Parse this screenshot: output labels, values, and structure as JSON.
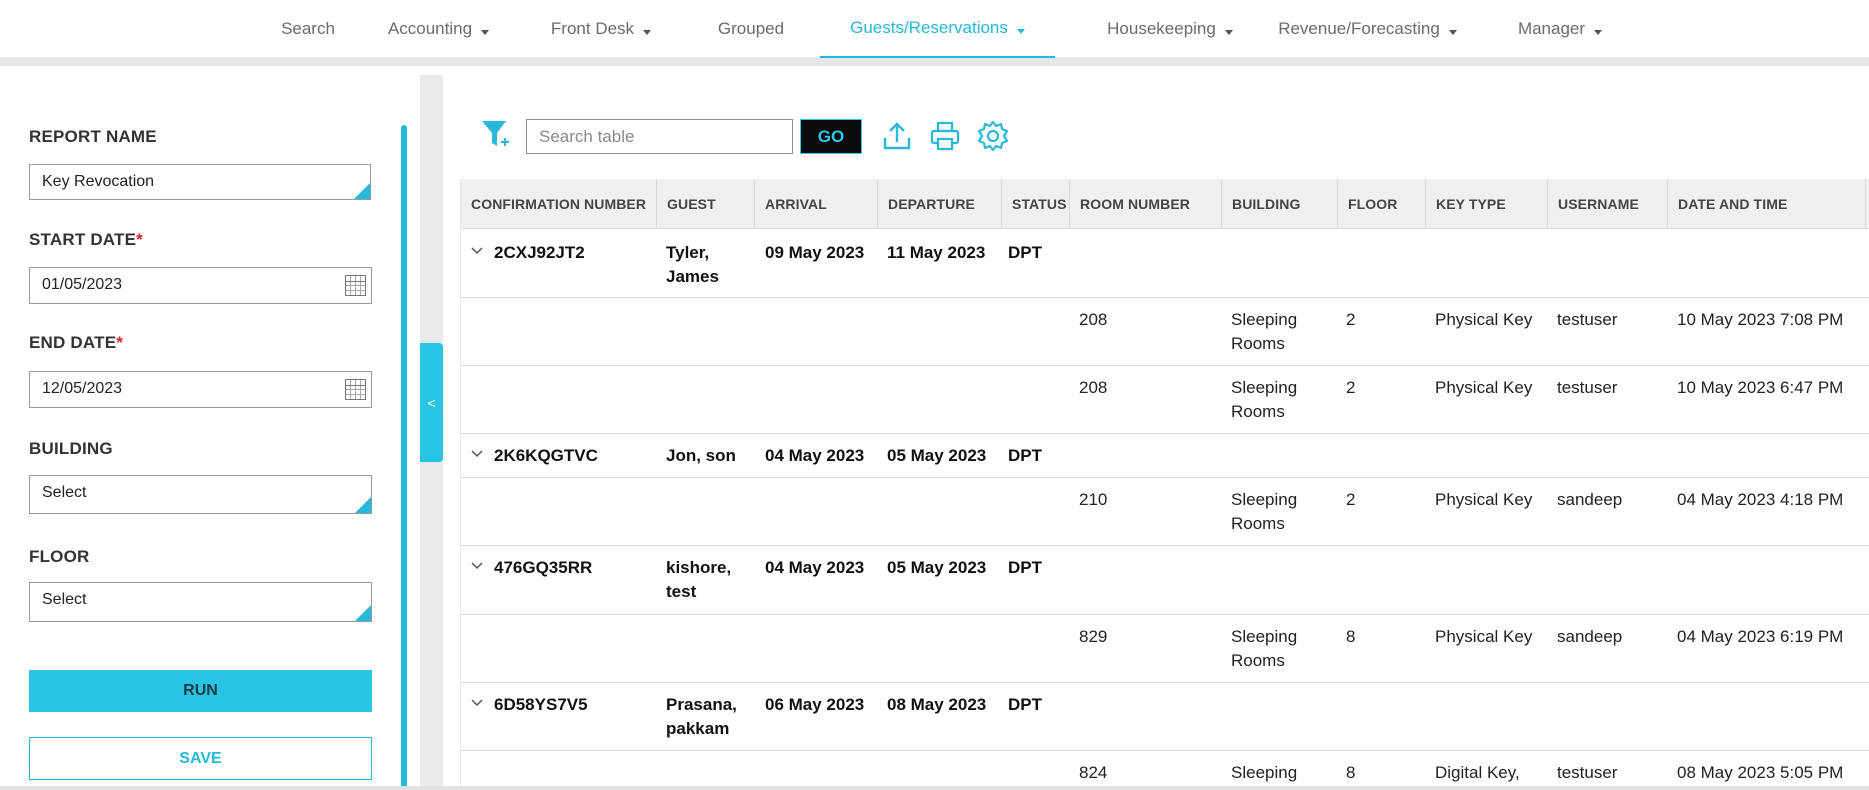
{
  "nav": {
    "items": [
      {
        "label": "Search",
        "dropdown": false,
        "active": false
      },
      {
        "label": "Accounting",
        "dropdown": true,
        "active": false
      },
      {
        "label": "Front Desk",
        "dropdown": true,
        "active": false
      },
      {
        "label": "Grouped",
        "dropdown": false,
        "active": false
      },
      {
        "label": "Guests/Reservations",
        "dropdown": true,
        "active": true
      },
      {
        "label": "Housekeeping",
        "dropdown": true,
        "active": false
      },
      {
        "label": "Revenue/Forecasting",
        "dropdown": true,
        "active": false
      },
      {
        "label": "Manager",
        "dropdown": true,
        "active": false
      }
    ]
  },
  "form": {
    "report_name_label": "REPORT NAME",
    "report_name_value": "Key Revocation",
    "start_date_label": "START DATE",
    "start_date_value": "01/05/2023",
    "end_date_label": "END DATE",
    "end_date_value": "12/05/2023",
    "required_mark": "*",
    "building_label": "BUILDING",
    "building_value": "Select",
    "floor_label": "FLOOR",
    "floor_value": "Select",
    "run_label": "RUN",
    "save_label": "SAVE",
    "collapse_glyph": "<"
  },
  "toolbar": {
    "search_placeholder": "Search table",
    "go_label": "GO"
  },
  "table": {
    "headers": [
      "CONFIRMATION NUMBER",
      "GUEST",
      "ARRIVAL",
      "DEPARTURE",
      "STATUS",
      "ROOM NUMBER",
      "BUILDING",
      "FLOOR",
      "KEY TYPE",
      "USERNAME",
      "DATE AND TIME"
    ],
    "groups": [
      {
        "confirmation": "2CXJ92JT2",
        "guest": "Tyler, James",
        "arrival": "09 May 2023",
        "departure": "11 May 2023",
        "status": "DPT",
        "details": [
          {
            "room": "208",
            "building": "Sleeping Rooms",
            "floor": "2",
            "key_type": "Physical Key",
            "username": "testuser",
            "datetime": "10 May 2023 7:08 PM"
          },
          {
            "room": "208",
            "building": "Sleeping Rooms",
            "floor": "2",
            "key_type": "Physical Key",
            "username": "testuser",
            "datetime": "10 May 2023 6:47 PM"
          }
        ]
      },
      {
        "confirmation": "2K6KQGTVC",
        "guest": "Jon, son",
        "arrival": "04 May 2023",
        "departure": "05 May 2023",
        "status": "DPT",
        "details": [
          {
            "room": "210",
            "building": "Sleeping Rooms",
            "floor": "2",
            "key_type": "Physical Key",
            "username": "sandeep",
            "datetime": "04 May 2023 4:18 PM"
          }
        ]
      },
      {
        "confirmation": "476GQ35RR",
        "guest": "kishore, test",
        "arrival": "04 May 2023",
        "departure": "05 May 2023",
        "status": "DPT",
        "details": [
          {
            "room": "829",
            "building": "Sleeping Rooms",
            "floor": "8",
            "key_type": "Physical Key",
            "username": "sandeep",
            "datetime": "04 May 2023 6:19 PM"
          }
        ]
      },
      {
        "confirmation": "6D58YS7V5",
        "guest": "Prasana, pakkam",
        "arrival": "06 May 2023",
        "departure": "08 May 2023",
        "status": "DPT",
        "details": [
          {
            "room": "824",
            "building": "Sleeping",
            "floor": "8",
            "key_type": "Digital Key,",
            "username": "testuser",
            "datetime": "08 May 2023 5:05 PM"
          }
        ]
      }
    ]
  },
  "colors": {
    "accent": "#28b9da",
    "header_bg": "#eef0f2",
    "go_bg": "#0b0b0b"
  }
}
